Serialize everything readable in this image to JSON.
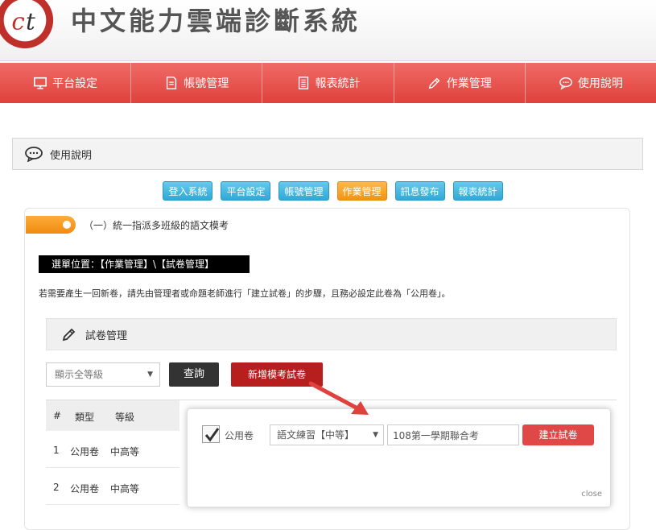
{
  "site": {
    "title": "中文能力雲端診斷系統",
    "logo_icon": "ct-logo-icon",
    "logo_color": "#c0302b"
  },
  "topnav": [
    {
      "label": "平台設定",
      "icon": "monitor-icon"
    },
    {
      "label": "帳號管理",
      "icon": "document-icon"
    },
    {
      "label": "報表統計",
      "icon": "report-icon"
    },
    {
      "label": "作業管理",
      "icon": "pencil-icon"
    },
    {
      "label": "使用說明",
      "icon": "chat-icon"
    }
  ],
  "help": {
    "title": "使用說明"
  },
  "tabs": [
    {
      "label": "登入系統",
      "active": false
    },
    {
      "label": "平台設定",
      "active": false
    },
    {
      "label": "帳號管理",
      "active": false
    },
    {
      "label": "作業管理",
      "active": true
    },
    {
      "label": "訊息發布",
      "active": false
    },
    {
      "label": "報表統計",
      "active": false
    }
  ],
  "section": {
    "title": "（一）統一指派多班級的語文模考",
    "menu_path": "選單位置：【作業管理】\\【試卷管理】",
    "notice": "若需要產生一回新卷，請先由管理者或命題老師進行「建立試卷」的步驟，且務必設定此卷為「公用卷」。"
  },
  "exam": {
    "title": "試卷管理",
    "level_select": "顯示全等級",
    "query_label": "查詢",
    "new_label": "新增模考試卷",
    "table": {
      "headers": [
        "#",
        "類型",
        "等級"
      ],
      "rows": [
        [
          "1",
          "公用卷",
          "中高等"
        ],
        [
          "2",
          "公用卷",
          "中高等"
        ]
      ]
    }
  },
  "popup": {
    "checkbox_label": "公用卷",
    "checked": true,
    "type_select": "語文練習【中等】",
    "name_value": "108第一學期聯合考",
    "create_label": "建立試卷",
    "close_label": "close"
  },
  "colors": {
    "nav": "#e0413c",
    "tab": "#30a9d8",
    "tab_active": "#f29412",
    "new_button": "#b71e1e",
    "create_button": "#e04848"
  }
}
